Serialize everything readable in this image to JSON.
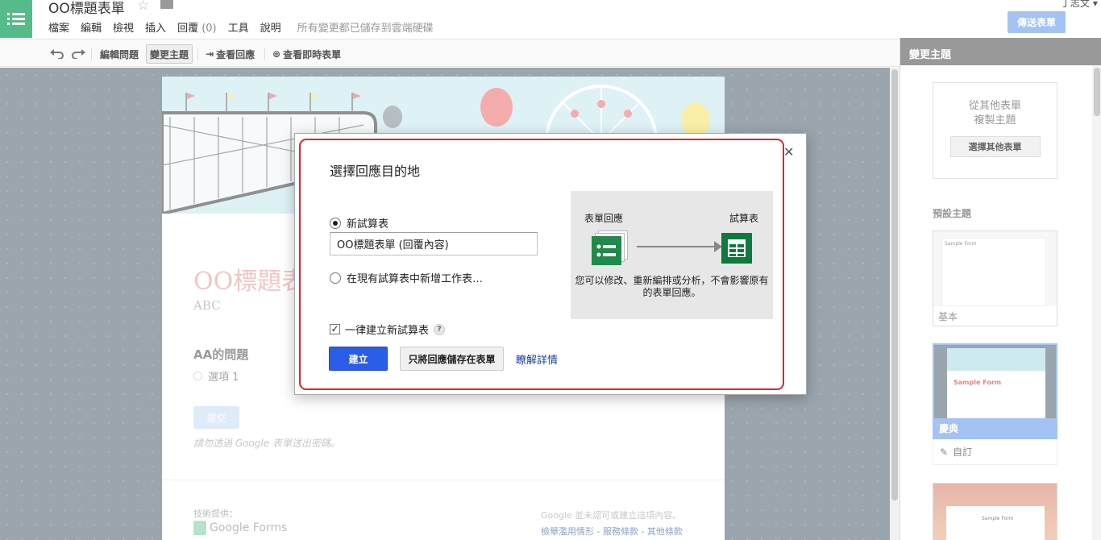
{
  "header": {
    "doc_title": "OO標題表單",
    "user_name": "丁志文",
    "send_form": "傳送表單"
  },
  "menu": {
    "file": "檔案",
    "edit": "編輯",
    "view": "檢視",
    "insert": "插入",
    "responses": "回覆",
    "responses_count": "(0)",
    "tools": "工具",
    "help": "說明",
    "saved_status": "所有變更都已儲存到雲端硬碟"
  },
  "toolbar": {
    "edit_questions": "編輯問題",
    "change_theme": "變更主題",
    "view_responses": "查看回應",
    "view_live_form": "查看即時表單"
  },
  "form": {
    "title": "OO標題表",
    "description": "ABC",
    "question": "AA的問題",
    "option1": "選項 1",
    "submit": "提交",
    "password_warning": "請勿透過 Google 表單送出密碼。",
    "powered_by": "技術提供：",
    "google_forms": "Google Forms",
    "disclaimer": "Google 並未認可或建立這項內容。",
    "legal_links": "檢舉濫用情形 - 服務條款 - 其他條款"
  },
  "side_panel": {
    "title": "變更主題",
    "copy_line1": "從其他表單",
    "copy_line2": "複製主題",
    "choose_other": "選擇其他表單",
    "default_themes": "預設主題",
    "themes": [
      {
        "name": "基本",
        "preview_title": "Sample Form"
      },
      {
        "name": "慶典",
        "preview_title": "Sample Form"
      },
      {
        "name": "",
        "preview_title": "Sample Form"
      }
    ],
    "customize": "自訂"
  },
  "dialog": {
    "title": "選擇回應目的地",
    "option_new_sheet": "新試算表",
    "new_sheet_name": "OO標題表單 (回覆內容)",
    "option_existing": "在現有試算表中新增工作表…",
    "always_new": "一律建立新試算表",
    "help": "?",
    "create": "建立",
    "keep_in_form": "只將回應儲存在表單",
    "learn_more": "瞭解詳情",
    "illus_left": "表單回應",
    "illus_right": "試算表",
    "illus_caption": "您可以修改、重新編排或分析，不會影響原有的表單回應。",
    "selected_option": "new_sheet",
    "always_new_checked": true
  },
  "colors": {
    "accent_blue": "#2a5ee8",
    "highlight_red": "#e0242b",
    "forms_green": "#56bb8a"
  }
}
